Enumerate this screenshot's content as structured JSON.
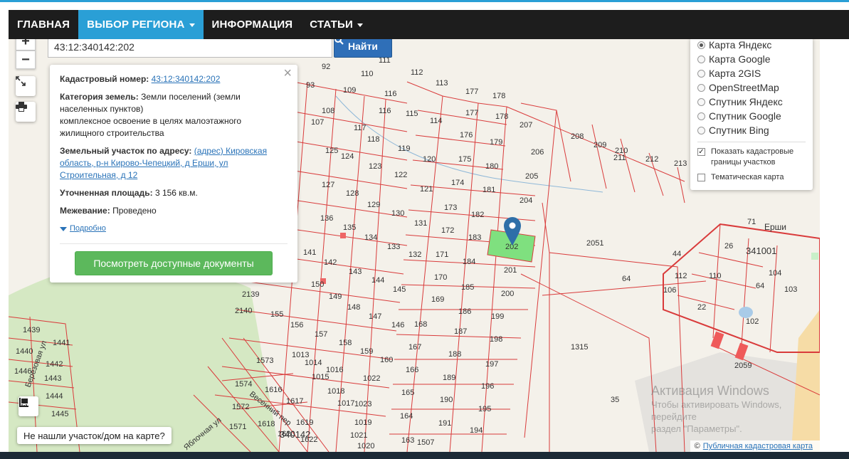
{
  "nav": {
    "items": [
      {
        "label": "ГЛАВНАЯ"
      },
      {
        "label": "ВЫБОР РЕГИОНА"
      },
      {
        "label": "ИНФОРМАЦИЯ"
      },
      {
        "label": "СТАТЬИ"
      }
    ]
  },
  "map_controls": {
    "zoom_in": "+",
    "zoom_out": "−"
  },
  "search": {
    "value": "43:12:340142:202",
    "button_label": "Найти"
  },
  "info": {
    "cad_num_label": "Кадастровый номер:",
    "cad_num_value": "43:12:340142:202",
    "category_label": "Категория земель:",
    "category_value": "Земли поселений (земли населенных пунктов)",
    "use_value": "комплексное освоение в целях малоэтажного жилищного строительства",
    "address_label": "Земельный участок по адресу:",
    "address_value": "(адрес) Кировская область, р-н Кирово-Чепецкий, д Ерши, ул Строительная, д 12",
    "area_label": "Уточненная площадь:",
    "area_value": "3 156 кв.м.",
    "survey_label": "Межевание:",
    "survey_value": "Проведено",
    "more_link": "Подробно",
    "docs_button": "Посмотреть доступные документы",
    "close": "×"
  },
  "layers": {
    "options": [
      {
        "label": "Карта Яндекс",
        "selected": true
      },
      {
        "label": "Карта Google",
        "selected": false
      },
      {
        "label": "Карта 2GIS",
        "selected": false
      },
      {
        "label": "OpenStreetMap",
        "selected": false
      },
      {
        "label": "Спутник Яндекс",
        "selected": false
      },
      {
        "label": "Спутник Google",
        "selected": false
      },
      {
        "label": "Спутник Bing",
        "selected": false
      }
    ],
    "show_cadastral": "Показать кадастровые границы участков",
    "show_cadastral_checked": true,
    "thematic": "Тематическая карта",
    "thematic_checked": false
  },
  "map_labels": {
    "parcels": [
      "92",
      "110",
      "111",
      "112",
      "113",
      "93",
      "109",
      "116",
      "177",
      "178",
      "108",
      "116",
      "115",
      "114",
      "177",
      "178",
      "207",
      "208",
      "209",
      "210",
      "211",
      "212",
      "213",
      "107",
      "117",
      "176",
      "179",
      "206",
      "125",
      "118",
      "119",
      "120",
      "175",
      "180",
      "205",
      "124",
      "123",
      "122",
      "121",
      "174",
      "181",
      "204",
      "127",
      "128",
      "129",
      "130",
      "131",
      "173",
      "182",
      "136",
      "135",
      "134",
      "133",
      "132",
      "172",
      "183",
      "2051",
      "141",
      "142",
      "143",
      "144",
      "145",
      "171",
      "184",
      "201",
      "150",
      "149",
      "148",
      "147",
      "146",
      "170",
      "185",
      "200",
      "2139",
      "2140",
      "155",
      "156",
      "157",
      "158",
      "159",
      "160",
      "169",
      "186",
      "199",
      "1439",
      "1441",
      "1440",
      "1442",
      "1443",
      "1444",
      "1445",
      "1446",
      "168",
      "187",
      "198",
      "167",
      "188",
      "197",
      "1573",
      "1574",
      "1013",
      "1014",
      "1015",
      "1016",
      "1022",
      "166",
      "189",
      "196",
      "1572",
      "1616",
      "1617",
      "1619",
      "1018",
      "1017",
      "1023",
      "165",
      "190",
      "195",
      "1315",
      "35",
      "1571",
      "1618",
      "1620",
      "1622",
      "1021",
      "1019",
      "164",
      "191",
      "194",
      "1020",
      "163",
      "1507",
      "64",
      "2059",
      "44",
      "26",
      "110",
      "104",
      "112",
      "106",
      "22",
      "64",
      "103",
      "102",
      "71",
      "202"
    ],
    "quarter": "340142",
    "quarter2": "341001",
    "settlement": "Ерши",
    "street1": "Весенний пер",
    "street2": "Березовая ул",
    "street3": "Яблочная ул"
  },
  "bottom": {
    "not_found": "Не нашли участок/дом на карте?"
  },
  "watermark": {
    "title": "Активация Windows",
    "line1": "Чтобы активировать Windows, перейдите",
    "line2": "раздел \"Параметры\"."
  },
  "attribution": {
    "symbol": "©",
    "link": "Публичная кадастровая карта"
  },
  "colors": {
    "nav_bg": "#1d1d1d",
    "nav_active": "#2a9fd6",
    "parcel_line": "#d93b3b",
    "selected_parcel": "#7fe07f",
    "docs_button": "#5cb85c",
    "pin": "#2e6fa8"
  }
}
